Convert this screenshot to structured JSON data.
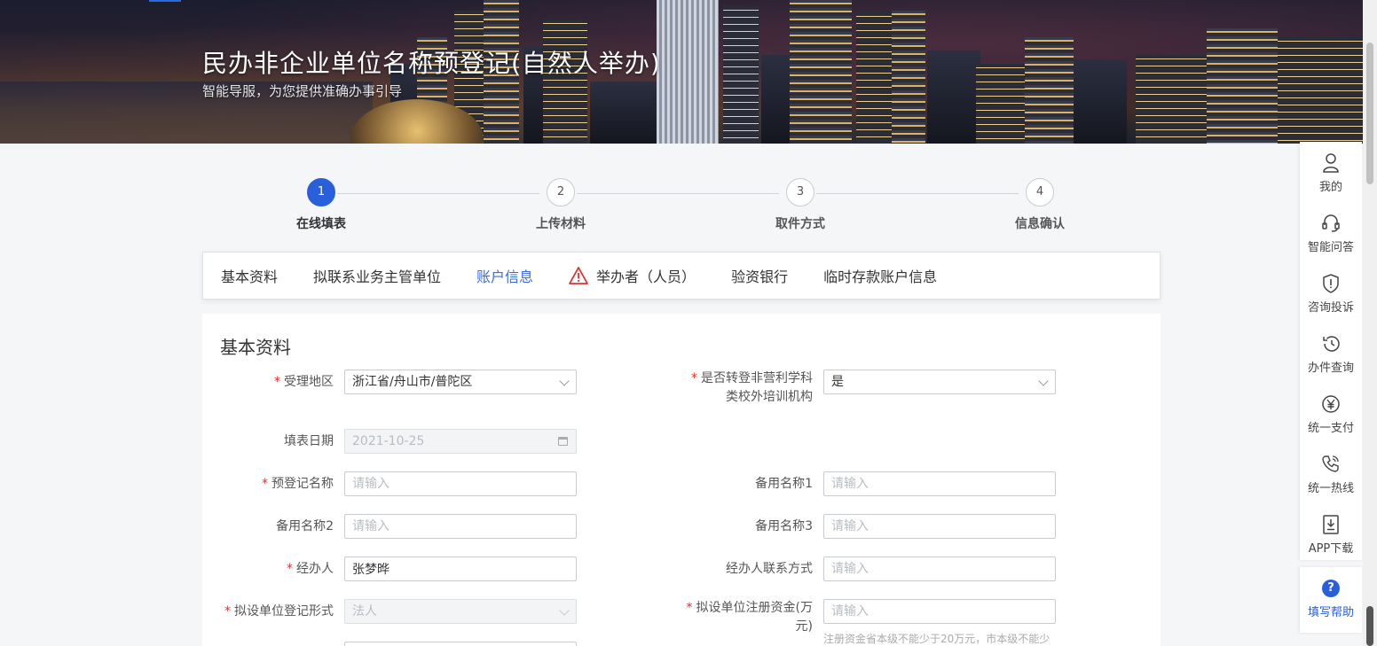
{
  "banner": {
    "title": "民办非企业单位名称预登记(自然人举办)",
    "subtitle": "智能导服，为您提供准确办事引导"
  },
  "steps": [
    {
      "number": "1",
      "label": "在线填表",
      "active": true
    },
    {
      "number": "2",
      "label": "上传材料",
      "active": false
    },
    {
      "number": "3",
      "label": "取件方式",
      "active": false
    },
    {
      "number": "4",
      "label": "信息确认",
      "active": false
    }
  ],
  "tabs": [
    {
      "label": "基本资料",
      "active": false
    },
    {
      "label": "拟联系业务主管单位",
      "active": false
    },
    {
      "label": "账户信息",
      "active": true
    },
    {
      "label": "举办者（人员）",
      "active": false,
      "icon": "warning-icon"
    },
    {
      "label": "验资银行",
      "active": false
    },
    {
      "label": "临时存款账户信息",
      "active": false
    }
  ],
  "form": {
    "section_title": "基本资料",
    "region_label": "受理地区",
    "region_value": "浙江省/舟山市/普陀区",
    "transfer_label_1": "是否转登非营利学科",
    "transfer_label_2": "类校外培训机构",
    "transfer_value": "是",
    "date_label": "填表日期",
    "date_value": "2021-10-25",
    "name_label": "预登记名称",
    "alt1_label": "备用名称1",
    "alt2_label": "备用名称2",
    "alt3_label": "备用名称3",
    "agent_label": "经办人",
    "agent_value": "张梦晔",
    "agent_contact_label": "经办人联系方式",
    "form_type_label": "拟设单位登记形式",
    "form_type_value": "法人",
    "capital_label_1": "拟设单位注册资金(万",
    "capital_label_2": "元)",
    "capital_hint": "注册资金省本级不能少于20万元，市本级不能少",
    "placeholder": "请输入",
    "required_mark": "*"
  },
  "toolbar": {
    "items": [
      {
        "label": "我的",
        "icon": "user-icon"
      },
      {
        "label": "智能问答",
        "icon": "headset-icon"
      },
      {
        "label": "咨询投诉",
        "icon": "shield-icon"
      },
      {
        "label": "办件查询",
        "icon": "history-icon"
      },
      {
        "label": "统一支付",
        "icon": "yuan-icon"
      },
      {
        "label": "统一热线",
        "icon": "phone-icon"
      },
      {
        "label": "APP下载",
        "icon": "download-icon"
      }
    ],
    "help_label": "填写帮助",
    "help_glyph": "?"
  },
  "colors": {
    "primary": "#2a5fdc",
    "tab_active": "#3a6ee0",
    "required": "#e03030"
  }
}
